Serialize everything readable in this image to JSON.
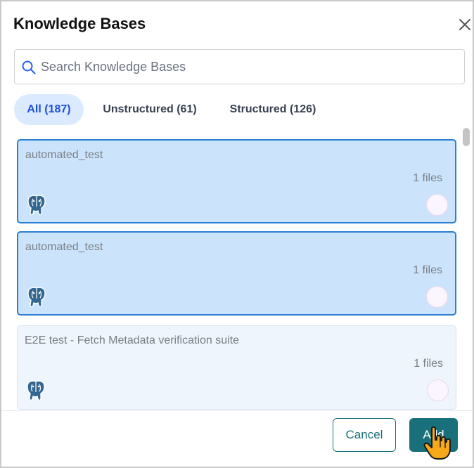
{
  "dialog": {
    "title": "Knowledge Bases",
    "close_icon": "close-icon"
  },
  "search": {
    "placeholder": "Search Knowledge Bases",
    "value": "",
    "icon": "search-icon"
  },
  "tabs": [
    {
      "label": "All (187)",
      "active": true
    },
    {
      "label": "Unstructured (61)",
      "active": false
    },
    {
      "label": "Structured (126)",
      "active": false
    }
  ],
  "items": [
    {
      "name": "automated_test",
      "files": "1 files",
      "selected": true,
      "icon": "postgresql-icon"
    },
    {
      "name": "automated_test",
      "files": "1 files",
      "selected": true,
      "icon": "postgresql-icon"
    },
    {
      "name": "E2E test - Fetch Metadata verification suite",
      "files": "1 files",
      "selected": false,
      "icon": "postgresql-icon"
    }
  ],
  "footer": {
    "cancel_label": "Cancel",
    "add_label": "Add"
  },
  "colors": {
    "accent": "#19707a",
    "selected_bg": "#cbe4fb",
    "selected_border": "#2b7fd2",
    "active_tab_bg": "#dbeafe",
    "active_tab_text": "#1d4ed8"
  }
}
